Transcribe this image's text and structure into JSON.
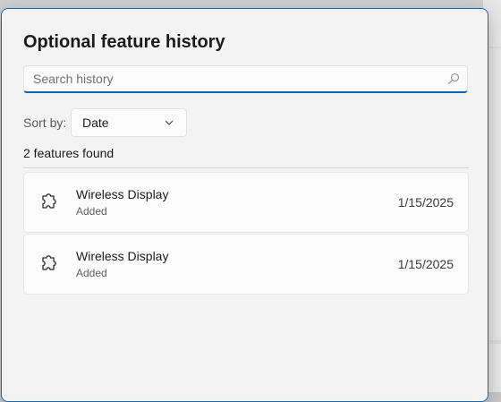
{
  "dialog": {
    "title": "Optional feature history",
    "search": {
      "placeholder": "Search history",
      "value": "",
      "icon": "search-icon"
    },
    "sort": {
      "label": "Sort by:",
      "selected": "Date",
      "icon": "chevron-down-icon"
    },
    "results_count": "2 features found",
    "items": [
      {
        "name": "Wireless Display",
        "status": "Added",
        "date": "1/15/2025",
        "icon": "puzzle-piece-icon"
      },
      {
        "name": "Wireless Display",
        "status": "Added",
        "date": "1/15/2025",
        "icon": "puzzle-piece-icon"
      }
    ]
  },
  "colors": {
    "accent": "#0067c0",
    "dialog_background": "#f3f3f3",
    "card_background": "#fbfbfb"
  }
}
